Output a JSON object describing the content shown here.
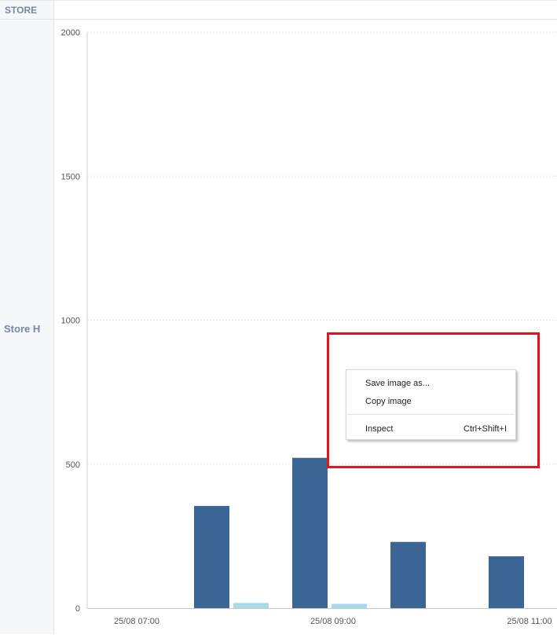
{
  "table": {
    "column_header": "STORE",
    "row_label": "Store H"
  },
  "context_menu": {
    "items": [
      {
        "label": "Save image as...",
        "shortcut": ""
      },
      {
        "label": "Copy image",
        "shortcut": ""
      },
      {
        "label": "Inspect",
        "shortcut": "Ctrl+Shift+I"
      }
    ]
  },
  "colors": {
    "series_primary": "#3a6594",
    "series_secondary": "#a8d9ea",
    "highlight": "#e3141c"
  },
  "chart_data": {
    "type": "bar",
    "title": "",
    "xlabel": "",
    "ylabel": "",
    "ylim": [
      0,
      2000
    ],
    "yticks": [
      0,
      500,
      1000,
      1500,
      2000
    ],
    "grid": true,
    "xtick_labels": [
      {
        "label": "25/08 07:00",
        "x": 7.0
      },
      {
        "label": "25/08 09:00",
        "x": 9.0
      },
      {
        "label": "25/08 11:00",
        "x": 11.0
      }
    ],
    "hours": [
      8,
      9,
      10,
      11
    ],
    "series": [
      {
        "values": [
          355,
          522,
          230,
          180
        ]
      },
      {
        "values": [
          18,
          15,
          0,
          0
        ]
      }
    ]
  }
}
